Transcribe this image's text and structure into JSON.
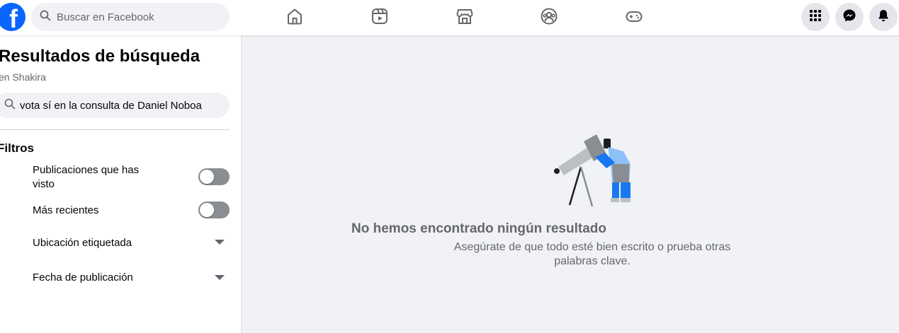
{
  "topbar": {
    "search_placeholder": "Buscar en Facebook",
    "logo_letter": "f",
    "nav": [
      "home-icon",
      "reels-icon",
      "marketplace-icon",
      "groups-icon",
      "gaming-icon"
    ],
    "actions": [
      "menu-grid-icon",
      "messenger-icon",
      "notifications-icon"
    ]
  },
  "sidebar": {
    "title": "Resultados de búsqueda",
    "subtitle": "en Shakira",
    "query": "vota sí en la consulta de Daniel Noboa",
    "filters_title": "Filtros",
    "filters": [
      {
        "label": "Publicaciones que has visto",
        "control": "toggle",
        "on": false
      },
      {
        "label": "Más recientes",
        "control": "toggle",
        "on": false
      },
      {
        "label": "Ubicación etiquetada",
        "control": "dropdown"
      },
      {
        "label": "Fecha de publicación",
        "control": "dropdown"
      }
    ]
  },
  "main": {
    "empty_title": "No hemos encontrado ningún resultado",
    "empty_desc": "Asegúrate de que todo esté bien escrito o prueba otras palabras clave."
  },
  "colors": {
    "brand": "#0866ff",
    "background": "#f0f2f5",
    "secondary_text": "#65676b",
    "toggle_off": "#8a8d91"
  }
}
